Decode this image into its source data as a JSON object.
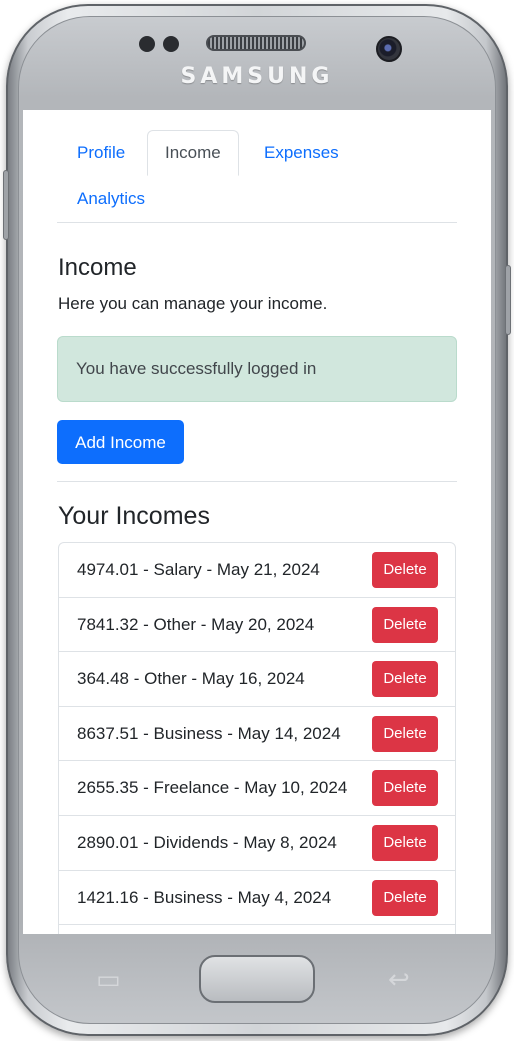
{
  "device": {
    "brand": "SAMSUNG"
  },
  "tabs": [
    {
      "label": "Profile",
      "active": false
    },
    {
      "label": "Income",
      "active": true
    },
    {
      "label": "Expenses",
      "active": false
    },
    {
      "label": "Analytics",
      "active": false
    }
  ],
  "page": {
    "title": "Income",
    "description": "Here you can manage your income.",
    "alert": "You have successfully logged in",
    "add_button": "Add Income",
    "list_title": "Your Incomes"
  },
  "incomes": [
    {
      "text": "4974.01 - Salary - May 21, 2024",
      "action": "Delete"
    },
    {
      "text": "7841.32 - Other - May 20, 2024",
      "action": "Delete"
    },
    {
      "text": "364.48 - Other - May 16, 2024",
      "action": "Delete"
    },
    {
      "text": "8637.51 - Business - May 14, 2024",
      "action": "Delete"
    },
    {
      "text": "2655.35 - Freelance - May 10, 2024",
      "action": "Delete"
    },
    {
      "text": "2890.01 - Dividends - May 8, 2024",
      "action": "Delete"
    },
    {
      "text": "1421.16 - Business - May 4, 2024",
      "action": "Delete"
    },
    {
      "text": "",
      "action": ""
    }
  ],
  "colors": {
    "primary": "#0d6efd",
    "danger": "#dc3545",
    "success_bg": "#d1e7dd"
  }
}
